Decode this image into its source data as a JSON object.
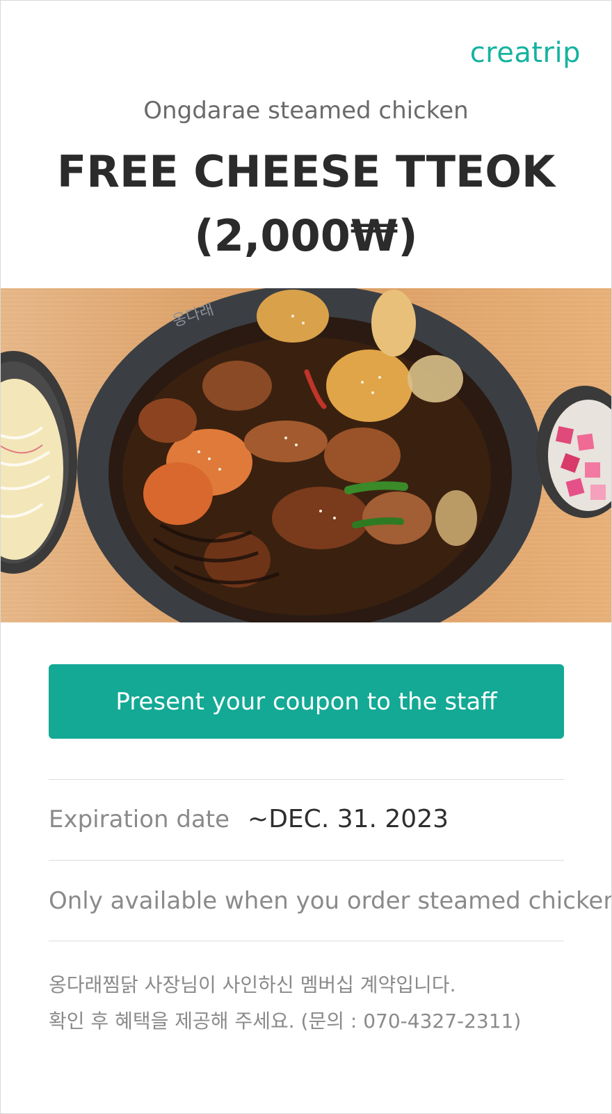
{
  "brand": {
    "logo_text": "creatrip",
    "accent": "#14b3a0"
  },
  "coupon": {
    "restaurant": "Ongdarae steamed chicken",
    "headline_line1": "FREE CHEESE TTEOK",
    "headline_line2": "(2,000₩)",
    "hero_image_alt": "steamed-chicken-dish-image"
  },
  "cta": {
    "label": "Present your coupon to the staff",
    "color": "#13a995"
  },
  "details": {
    "expiration_label": "Expiration date",
    "expiration_value": "~DEC. 31. 2023",
    "condition": "Only available when you order steamed chicken",
    "notice_line1": "옹다래찜닭 사장님이 사인하신 멤버십 계약입니다.",
    "notice_line2": "확인 후 혜택을 제공해 주세요. (문의 : 070-4327-2311)"
  }
}
